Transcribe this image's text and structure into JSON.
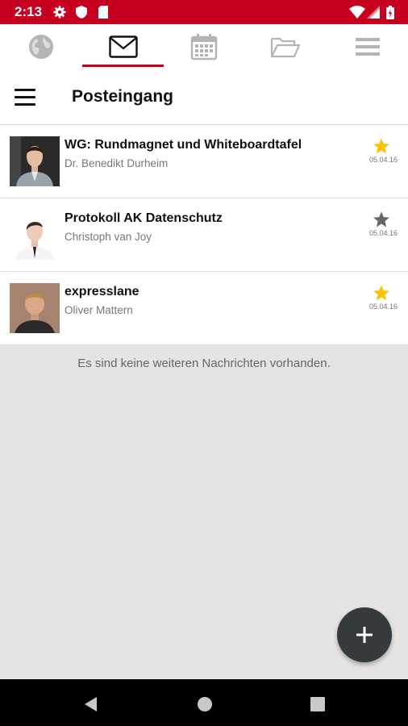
{
  "status_bar": {
    "time": "2:13",
    "icons": [
      "settings-gear-icon",
      "shield-icon",
      "sd-card-icon",
      "wifi-icon",
      "signal-icon",
      "battery-icon"
    ]
  },
  "tabs": [
    {
      "name": "globe-tab",
      "icon": "globe-icon",
      "active": false
    },
    {
      "name": "mail-tab",
      "icon": "envelope-icon",
      "active": true
    },
    {
      "name": "calendar-tab",
      "icon": "calendar-icon",
      "active": false
    },
    {
      "name": "folder-tab",
      "icon": "folder-open-icon",
      "active": false
    },
    {
      "name": "more-tab",
      "icon": "list-icon",
      "active": false
    }
  ],
  "toolbar": {
    "title": "Posteingang"
  },
  "messages": [
    {
      "subject": "WG: Rundmagnet und Whiteboardtafel",
      "sender": "Dr. Benedikt Durheim",
      "date": "05.04.16",
      "starred": true
    },
    {
      "subject": "Protokoll AK Datenschutz",
      "sender": "Christoph van Joy",
      "date": "05.04.16",
      "starred": false
    },
    {
      "subject": "expresslane",
      "sender": "Oliver Mattern",
      "date": "05.04.16",
      "starred": true
    }
  ],
  "empty_message": "Es sind keine weiteren Nachrichten vorhanden.",
  "fab": {
    "label": "+"
  },
  "colors": {
    "accent": "#c8001f",
    "star_active": "#f7c400",
    "star_inactive": "#666666",
    "fab": "#353a3d"
  }
}
